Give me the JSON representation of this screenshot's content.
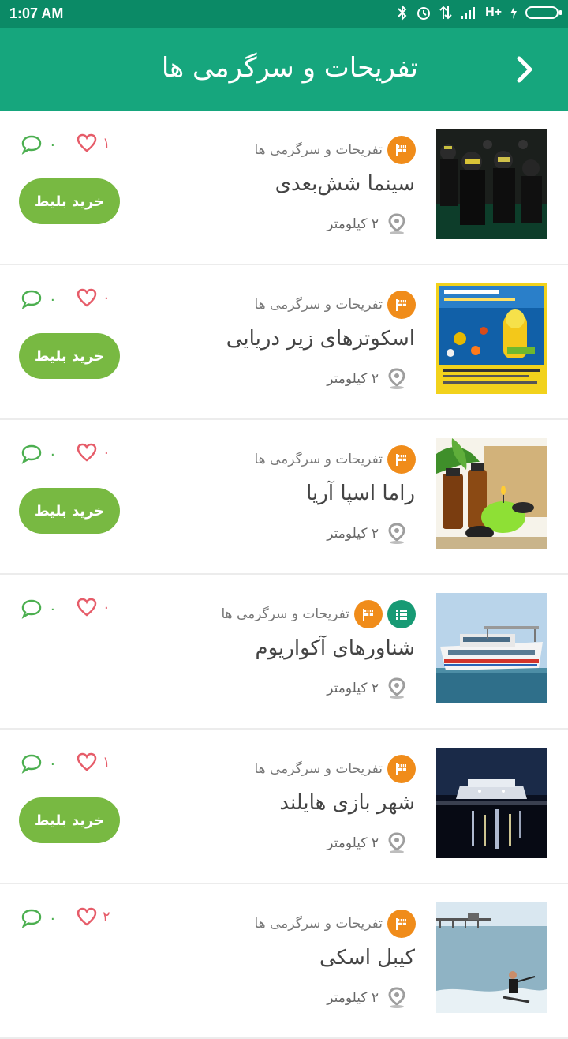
{
  "status_bar": {
    "time": "1:07 AM",
    "network": "H+"
  },
  "header": {
    "title": "تفریحات و سرگرمی ها"
  },
  "items": [
    {
      "category": "تفریحات و سرگرمی ها",
      "name": "سینما شش‌بعدی",
      "distance": "۲ کیلومتر",
      "likes": "۱",
      "comments": "۰",
      "buy_label": "خرید بلیط"
    },
    {
      "category": "تفریحات و سرگرمی ها",
      "name": "اسکوترهای زیر دریایی",
      "distance": "۲ کیلومتر",
      "likes": "۰",
      "comments": "۰",
      "buy_label": "خرید بلیط"
    },
    {
      "category": "تفریحات و سرگرمی ها",
      "name": "راما اسپا آریا",
      "distance": "۲ کیلومتر",
      "likes": "۰",
      "comments": "۰",
      "buy_label": "خرید بلیط"
    },
    {
      "category": "تفریحات و سرگرمی ها",
      "name": "شناورهای آکواریوم",
      "distance": "۲ کیلومتر",
      "likes": "۰",
      "comments": "۰"
    },
    {
      "category": "تفریحات و سرگرمی ها",
      "name": "شهر بازی هایلند",
      "distance": "۲ کیلومتر",
      "likes": "۱",
      "comments": "۰",
      "buy_label": "خرید بلیط"
    },
    {
      "category": "تفریحات و سرگرمی ها",
      "name": "کیبل اسکی",
      "distance": "۲ کیلومتر",
      "likes": "۲",
      "comments": "۰"
    }
  ],
  "colors": {
    "header": "#16a67d",
    "status_bar": "#0b8a66",
    "buy_button": "#78b942",
    "category_badge": "#f08c1a",
    "like": "#e65c69",
    "comment": "#4caf50"
  },
  "icons": {
    "back": "chevron-right-icon",
    "category": "flag-icon",
    "list": "list-icon",
    "location": "location-pin-icon",
    "like": "heart-icon",
    "comment": "chat-bubble-icon"
  }
}
